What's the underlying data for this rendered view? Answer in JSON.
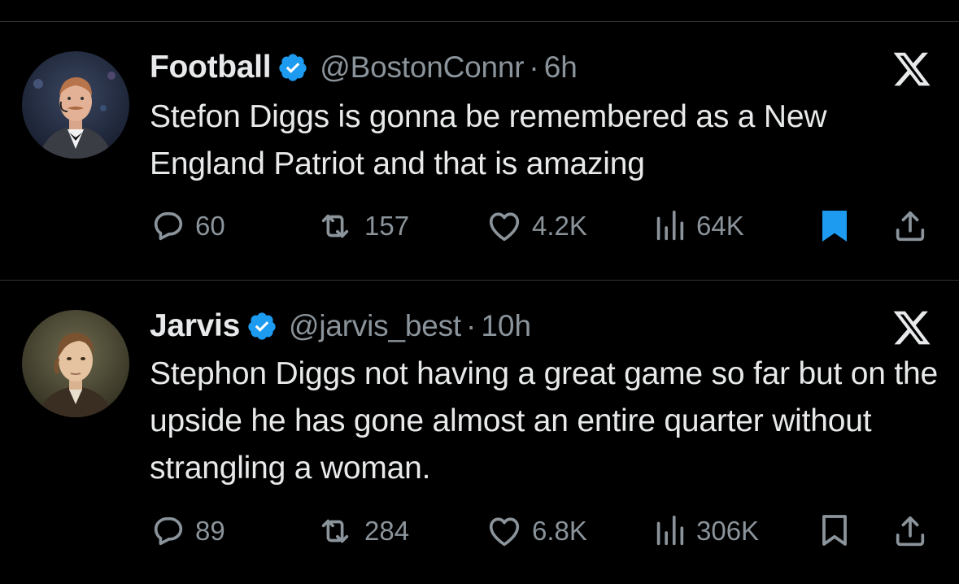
{
  "tweets": [
    {
      "name": "Football",
      "handle": "@BostonConnr",
      "separator": "·",
      "time": "6h",
      "text": "Stefon Diggs is gonna be remembered as a New England Patriot and that is amazing",
      "replies": "60",
      "reposts": "157",
      "likes": "4.2K",
      "views": "64K",
      "bookmarked": true
    },
    {
      "name": "Jarvis",
      "handle": "@jarvis_best",
      "separator": "·",
      "time": "10h",
      "text": "Stephon Diggs not having a great game so far but on the upside he has gone almost an entire quarter without strangling a woman.",
      "replies": "89",
      "reposts": "284",
      "likes": "6.8K",
      "views": "306K",
      "bookmarked": false
    }
  ],
  "colors": {
    "background": "#000000",
    "text": "#e7e9ea",
    "secondary": "#8b949b",
    "verified": "#1d9bf0",
    "bookmark_active": "#1d9bf0",
    "divider": "#2f3336"
  },
  "icons": [
    "verified-badge-icon",
    "x-logo-icon",
    "reply-icon",
    "repost-icon",
    "like-icon",
    "views-icon",
    "bookmark-icon",
    "share-icon"
  ]
}
